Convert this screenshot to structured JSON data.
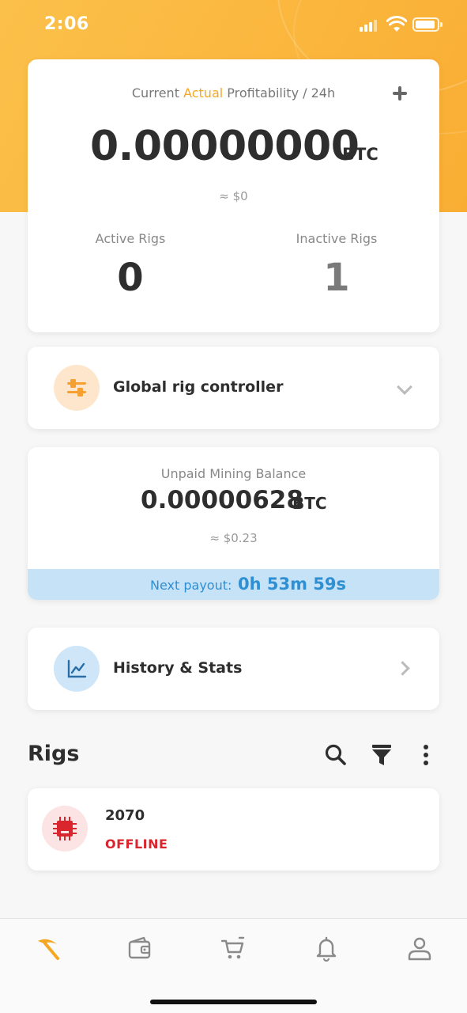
{
  "status_bar": {
    "time": "2:06"
  },
  "profitability": {
    "caption_prefix": "Current ",
    "caption_accent": "Actual",
    "caption_suffix": " Profitability / 24h",
    "value": "0.00000000",
    "unit": "BTC",
    "fiat": "≈ $0",
    "active_label": "Active Rigs",
    "active_value": "0",
    "inactive_label": "Inactive Rigs",
    "inactive_value": "1"
  },
  "controller": {
    "title": "Global rig controller"
  },
  "balance": {
    "label": "Unpaid Mining Balance",
    "value": "0.00000628",
    "unit": "BTC",
    "fiat": "≈ $0.23",
    "payout_label": "Next payout:",
    "payout_time": "0h 53m 59s"
  },
  "history": {
    "title": "History & Stats"
  },
  "rigs": {
    "title": "Rigs",
    "items": [
      {
        "name": "2070",
        "status": "OFFLINE"
      }
    ]
  },
  "tabs": [
    {
      "icon": "pickaxe-icon",
      "active": true
    },
    {
      "icon": "wallet-icon",
      "active": false
    },
    {
      "icon": "cart-icon",
      "active": false
    },
    {
      "icon": "bell-icon",
      "active": false
    },
    {
      "icon": "user-icon",
      "active": false
    }
  ],
  "colors": {
    "accent": "#f5a623",
    "payout_blue": "#2f8fd3",
    "offline_red": "#d9262e"
  }
}
